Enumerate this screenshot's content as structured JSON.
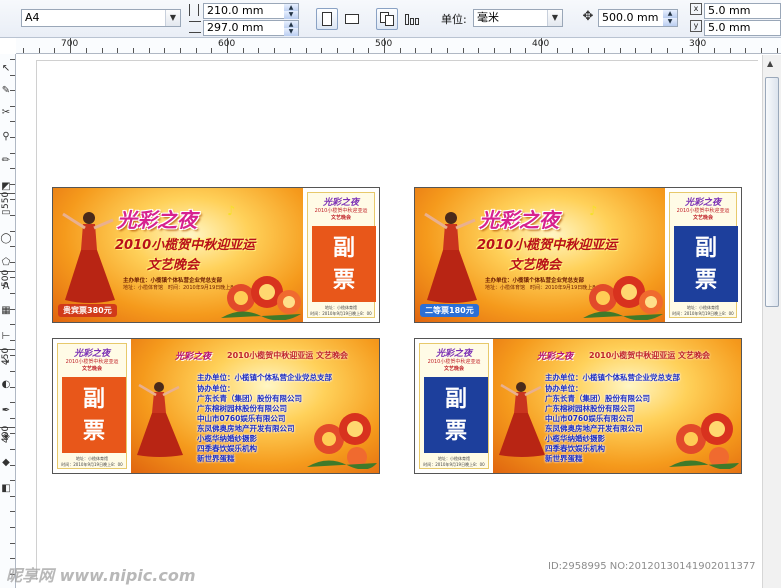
{
  "toolbar": {
    "page_size": "A4",
    "width": "210.0 mm",
    "height": "297.0 mm",
    "units_label": "单位:",
    "units_value": "毫米",
    "nudge": "500.0 mm",
    "dup_x": "5.0 mm",
    "dup_y": "5.0 mm"
  },
  "ruler": {
    "h_labels": [
      "700",
      "600",
      "500",
      "400",
      "300"
    ],
    "v_labels": [
      "550",
      "500",
      "450",
      "400"
    ]
  },
  "tickets": {
    "t1": {
      "title": "光彩之夜",
      "subtitle": "2010小榄贺中秋迎亚运",
      "subtitle2": "文艺晚会",
      "organizer": "主办单位：小榄镇个体私营企业党总支部",
      "info": "地址：小榄体育馆　时间：2010年9月19日晚上8：00",
      "price": "贵宾票380元",
      "stub_title": "光彩之夜",
      "stub_line1": "2010小榄贺中秋迎亚运",
      "stub_line2": "文艺晚会",
      "fu": "副",
      "piao": "票",
      "stub_addr": "地址：小榄体育馆",
      "stub_time": "时间：2010年9月19日晚上8：00"
    },
    "t2": {
      "title": "光彩之夜",
      "subtitle": "2010小榄贺中秋迎亚运",
      "subtitle2": "文艺晚会",
      "organizer": "主办单位：小榄镇个体私营企业党总支部",
      "info": "地址：小榄体育馆　时间：2010年9月19日晚上8：00",
      "price": "二等票180元",
      "stub_title": "光彩之夜",
      "stub_line1": "2010小榄贺中秋迎亚运",
      "stub_line2": "文艺晚会",
      "fu": "副",
      "piao": "票",
      "stub_addr": "地址：小榄体育馆",
      "stub_time": "时间：2010年9月19日晚上8：00"
    },
    "back": {
      "title": "光彩之夜",
      "headline": "2010小榄贺中秋迎亚运 文艺晚会",
      "organizer": "主办单位：小榄镇个体私营企业党总支部",
      "co_label": "协办单位：",
      "co": [
        "广东长青（集团）股份有限公司",
        "广东榕树园林股份有限公司",
        "中山市0760娱乐有限公司",
        "东凤佛奥房地产开发有限公司",
        "小榄华纳婚纱摄影",
        "四季春饮娱乐机构",
        "新世界蛋糕"
      ],
      "stub_title": "光彩之夜",
      "stub_line1": "2010小榄贺中秋迎亚运",
      "stub_line2": "文艺晚会",
      "fu": "副",
      "piao": "票",
      "stub_addr": "地址：小榄体育馆",
      "stub_time": "时间：2010年9月19日晚上8：00"
    }
  },
  "watermark": {
    "left": "昵享网 www.nipic.com",
    "right": "ID:2958995 NO:20120130141902011377"
  },
  "colors": {
    "orange_stub": "#e8571a",
    "blue_stub": "#1d3f9c",
    "price_blue": "#2b6fd6"
  }
}
